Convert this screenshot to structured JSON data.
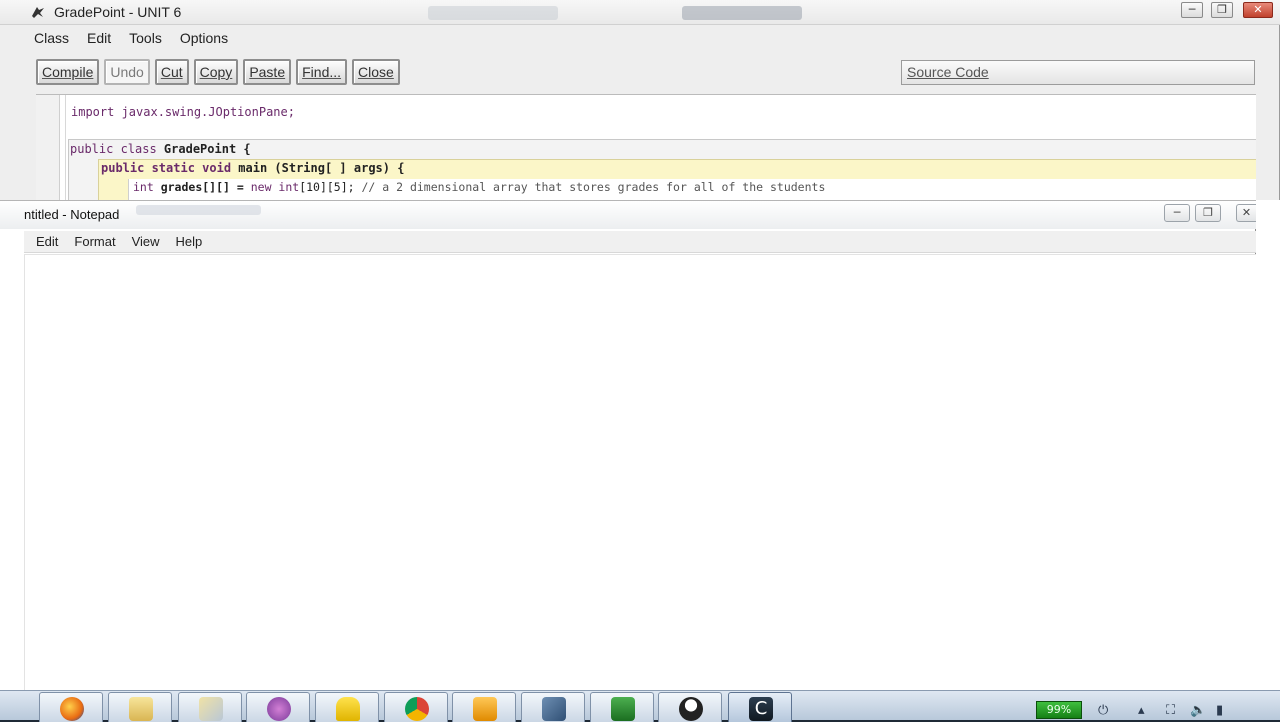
{
  "bluej": {
    "title": "GradePoint - UNIT 6",
    "menu": [
      "Class",
      "Edit",
      "Tools",
      "Options"
    ],
    "toolbar": {
      "compile": "Compile",
      "undo": "Undo",
      "cut": "Cut",
      "copy": "Copy",
      "paste": "Paste",
      "find": "Find...",
      "close": "Close"
    },
    "view_select": "Source Code",
    "code": {
      "line1": "import javax.swing.JOptionPane;",
      "line2_kw": "public class",
      "line2_name": " GradePoint {",
      "line3_kw": "public static void",
      "line3_name": " main (String[ ] args) {",
      "line4_kw": "int",
      "line4_mid": " grades[][] = ",
      "line4_kw2": "new int",
      "line4_rest": "[10][5]; ",
      "line4_comment": "// a 2 dimensional array that stores grades for all of the students"
    }
  },
  "notepad": {
    "title": "ntitled - Notepad",
    "menu": [
      "Edit",
      "Format",
      "View",
      "Help"
    ],
    "content": ""
  },
  "taskbar": {
    "apps": [
      "firefox-icon",
      "folder-icon",
      "files-icon",
      "paint-icon",
      "aim-icon",
      "chrome-icon",
      "outlook-icon",
      "bluej-icon",
      "excel-icon",
      "penguin-icon",
      "camtasia-icon"
    ],
    "battery": "99%"
  },
  "colors": {
    "method_scope": "#fbf6c8",
    "class_scope": "#f3f3f3",
    "taskbar": "#c8d6e6"
  }
}
